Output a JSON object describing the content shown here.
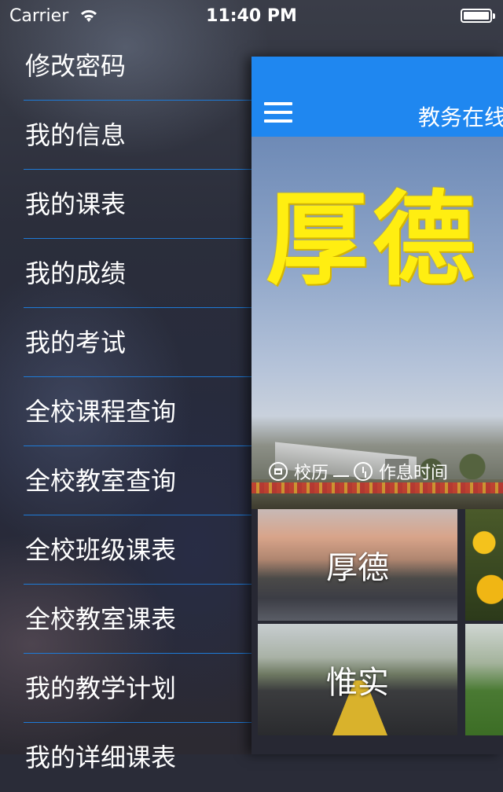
{
  "status_bar": {
    "carrier": "Carrier",
    "time": "11:40 PM",
    "wifi_icon": "wifi-icon",
    "battery_icon": "battery-icon"
  },
  "menu": {
    "items": [
      {
        "label": "修改密码"
      },
      {
        "label": "我的信息"
      },
      {
        "label": "我的课表"
      },
      {
        "label": "我的成绩"
      },
      {
        "label": "我的考试"
      },
      {
        "label": "全校课程查询"
      },
      {
        "label": "全校教室查询"
      },
      {
        "label": "全校班级课表"
      },
      {
        "label": "全校教室课表"
      },
      {
        "label": "我的教学计划"
      },
      {
        "label": "我的详细课表"
      }
    ],
    "divider_color": "#1e7bd8"
  },
  "main": {
    "navbar": {
      "title": "教务在线",
      "menu_icon": "hamburger-icon",
      "color": "#1f87f0"
    },
    "hero": {
      "motto": "厚德",
      "links": [
        {
          "label": "校历",
          "icon": "calendar-icon"
        },
        {
          "label": "作息时间",
          "icon": "clock-icon"
        }
      ]
    },
    "tiles": [
      {
        "label": "厚德"
      },
      {
        "label": ""
      },
      {
        "label": "惟实"
      },
      {
        "label": ""
      }
    ]
  }
}
